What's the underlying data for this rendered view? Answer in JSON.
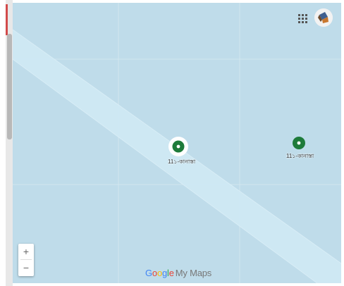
{
  "map": {
    "colors": {
      "water": "#bfdcea",
      "road_band": "#cfe8f3",
      "grid_line": "#d6e8f0",
      "marker_green": "#1e7b3a"
    },
    "markers": [
      {
        "label": "11১-কানাস্তা",
        "icon": "place-marker-icon",
        "selected": true
      },
      {
        "label": "11১-কানাস্তা",
        "icon": "place-marker-icon",
        "selected": false
      }
    ]
  },
  "toolbar": {
    "apps_icon": "apps-grid-icon",
    "avatar_icon": "account-avatar-icon"
  },
  "zoom": {
    "in_label": "+",
    "out_label": "−"
  },
  "attribution": {
    "google_letters": [
      "G",
      "o",
      "o",
      "g",
      "l",
      "e"
    ],
    "product": "My Maps"
  }
}
